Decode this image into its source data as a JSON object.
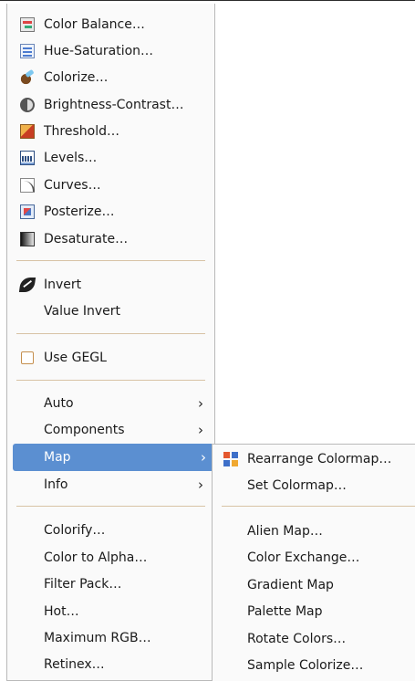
{
  "main_menu": {
    "items": [
      {
        "label": "Color Balance…",
        "icon": "color-balance-icon"
      },
      {
        "label": "Hue-Saturation…",
        "icon": "hue-saturation-icon"
      },
      {
        "label": "Colorize…",
        "icon": "colorize-icon"
      },
      {
        "label": "Brightness-Contrast…",
        "icon": "brightness-contrast-icon"
      },
      {
        "label": "Threshold…",
        "icon": "threshold-icon"
      },
      {
        "label": "Levels…",
        "icon": "levels-icon"
      },
      {
        "label": "Curves…",
        "icon": "curves-icon"
      },
      {
        "label": "Posterize…",
        "icon": "posterize-icon"
      },
      {
        "label": "Desaturate…",
        "icon": "desaturate-icon"
      },
      {
        "label": "Invert",
        "icon": "invert-icon"
      },
      {
        "label": "Value Invert"
      },
      {
        "label": "Use GEGL",
        "checkbox": false
      },
      {
        "label": "Auto",
        "submenu": true
      },
      {
        "label": "Components",
        "submenu": true
      },
      {
        "label": "Map",
        "submenu": true,
        "highlighted": true
      },
      {
        "label": "Info",
        "submenu": true
      },
      {
        "label": "Colorify…"
      },
      {
        "label": "Color to Alpha…"
      },
      {
        "label": "Filter Pack…"
      },
      {
        "label": "Hot…"
      },
      {
        "label": "Maximum RGB…"
      },
      {
        "label": "Retinex…"
      }
    ]
  },
  "map_submenu": {
    "items": [
      {
        "label": "Rearrange Colormap…",
        "icon": "rearrange-colormap-icon"
      },
      {
        "label": "Set Colormap…"
      },
      {
        "label": "Alien Map…"
      },
      {
        "label": "Color Exchange…"
      },
      {
        "label": "Gradient Map"
      },
      {
        "label": "Palette Map"
      },
      {
        "label": "Rotate Colors…"
      },
      {
        "label": "Sample Colorize…"
      }
    ]
  },
  "colors": {
    "highlight": "#5b8fd1",
    "separator": "#d8c3a5",
    "menu_background": "#fafafa"
  }
}
